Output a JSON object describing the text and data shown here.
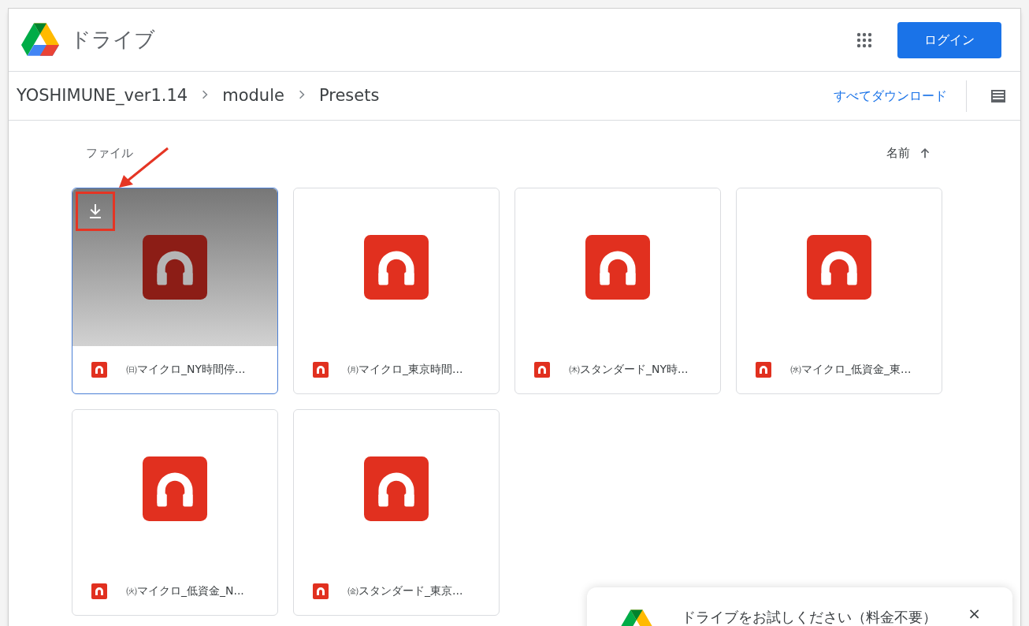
{
  "header": {
    "app_name": "ドライブ",
    "login_button": "ログイン"
  },
  "breadcrumb": [
    "YOSHIMUNE_ver1.14",
    "module",
    "Presets"
  ],
  "download_all": "すべてダウンロード",
  "section_label": "ファイル",
  "sort_label": "名前",
  "files": [
    {
      "name": "㈰マイクロ_NY時間停...",
      "selected": true
    },
    {
      "name": "㈪マイクロ_東京時間...",
      "selected": false
    },
    {
      "name": "㈭スタンダード_NY時...",
      "selected": false
    },
    {
      "name": "㈬マイクロ_低資金_東...",
      "selected": false
    },
    {
      "name": "㈫マイクロ_低資金_N...",
      "selected": false
    },
    {
      "name": "㈮スタンダード_東京...",
      "selected": false
    }
  ],
  "promo": {
    "title": "ドライブをお試しください（料金不要）",
    "close": "×"
  }
}
